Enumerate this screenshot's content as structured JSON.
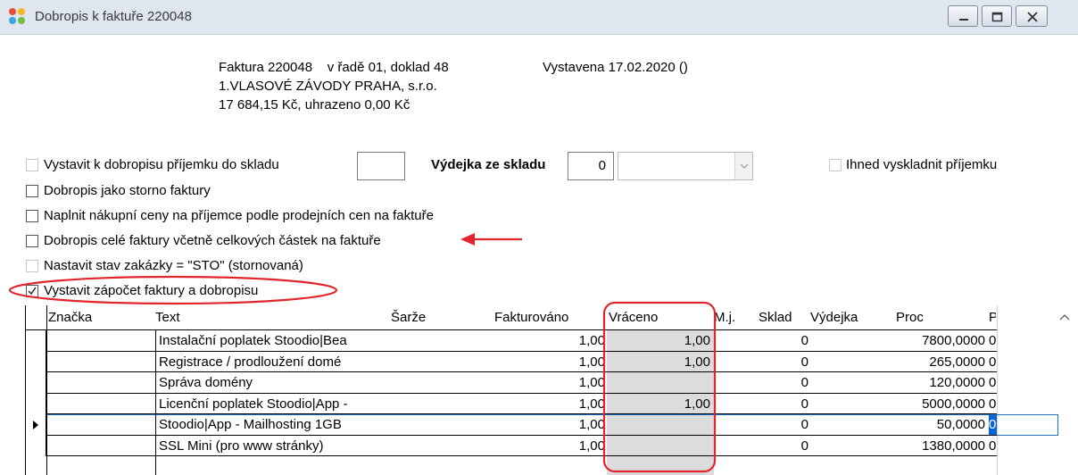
{
  "window": {
    "title": "Dobropis k faktuře 220048",
    "icon": "app-logo-icon",
    "controls": [
      "minimize-icon",
      "maximize-icon",
      "close-icon"
    ]
  },
  "header": {
    "line1a": "Faktura 220048    v řadě 01, doklad 48",
    "line1b": "Vystavena 17.02.2020 ()",
    "line2": "1.VLASOVÉ ZÁVODY PRAHA, s.r.o.",
    "line3": "17 684,15 Kč, uhrazeno 0,00 Kč"
  },
  "options": {
    "prijemka_label": "Vystavit k dobropisu příjemku do skladu",
    "prijemka_sklad_value": "",
    "vydejka_label": "Výdejka ze skladu",
    "vydejka_value": "0",
    "vydejka_select_value": "",
    "ihned_label": "Ihned vyskladnit příjemku",
    "storno_label": "Dobropis jako storno faktury",
    "naplnit_label": "Naplnit nákupní ceny na příjemce podle prodejních cen na faktuře",
    "cele_label": "Dobropis celé faktury včetně celkových částek na faktuře",
    "stav_label": "Nastavit stav zakázky = \"STO\" (stornovaná)",
    "zapocet_label": "Vystavit zápočet faktury a dobropisu",
    "zapocet_checked": true
  },
  "table": {
    "headers": {
      "znacka": "Značka",
      "text": "Text",
      "sarze": "Šarže",
      "fakturovano": "Fakturováno",
      "vraceno": "Vráceno",
      "mj": "M.j.",
      "sklad": "Sklad",
      "vydejka": "Výdejka",
      "proc": "Proc",
      "p": "P"
    },
    "rows": [
      {
        "znacka": "",
        "text": "Instalační poplatek Stoodio|Bea",
        "sarze": "",
        "fakturovano": "1,00",
        "vraceno": "1,00",
        "mj": "",
        "sklad": "0",
        "vydejka": "",
        "proc": "7800,0000",
        "p": "0"
      },
      {
        "znacka": "",
        "text": "Registrace / prodloužení domé",
        "sarze": "",
        "fakturovano": "1,00",
        "vraceno": "1,00",
        "mj": "",
        "sklad": "0",
        "vydejka": "",
        "proc": "265,0000",
        "p": "0"
      },
      {
        "znacka": "",
        "text": "Správa domény",
        "sarze": "",
        "fakturovano": "1,00",
        "vraceno": "",
        "mj": "",
        "sklad": "0",
        "vydejka": "",
        "proc": "120,0000",
        "p": "0"
      },
      {
        "znacka": "",
        "text": "Licenční poplatek Stoodio|App -",
        "sarze": "",
        "fakturovano": "1,00",
        "vraceno": "1,00",
        "mj": "",
        "sklad": "0",
        "vydejka": "",
        "proc": "5000,0000",
        "p": "0"
      },
      {
        "znacka": "",
        "text": "Stoodio|App - Mailhosting 1GB",
        "sarze": "",
        "fakturovano": "1,00",
        "vraceno": "",
        "mj": "",
        "sklad": "0",
        "vydejka": "",
        "proc": "50,0000",
        "p": "0"
      },
      {
        "znacka": "",
        "text": "SSL Mini (pro www stránky)",
        "sarze": "",
        "fakturovano": "1,00",
        "vraceno": "",
        "mj": "",
        "sklad": "0",
        "vydejka": "",
        "proc": "1380,0000",
        "p": "0"
      }
    ],
    "current_row": 4,
    "current_row_icon": "row-pointer-icon"
  },
  "annotations": {
    "color": "#e0262b",
    "arrow_icon": "red-arrow-icon"
  }
}
